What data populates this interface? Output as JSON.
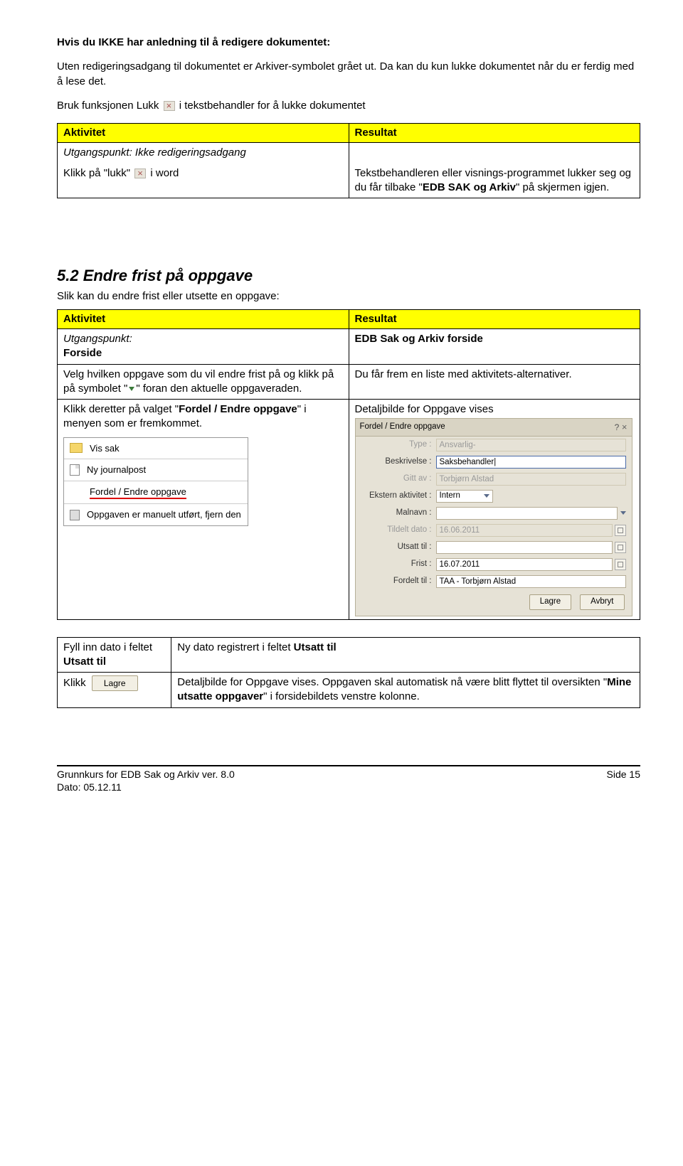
{
  "header": {
    "title": "Hvis du IKKE har anledning til å redigere dokumentet:",
    "intro_para": "Uten redigeringsadgang til dokumentet er Arkiver-symbolet grået ut. Da kan du kun lukke dokumentet når du er ferdig med å lese det.",
    "bruk_pre": "Bruk funksjonen Lukk ",
    "bruk_post": " i tekstbehandler for å lukke dokumentet"
  },
  "table1": {
    "head_a": "Aktivitet",
    "head_r": "Resultat",
    "utg_label": "Utgangspunkt: Ikke redigeringsadgang",
    "klikk_pre": "Klikk på \"lukk\" ",
    "klikk_post": " i word",
    "result_pre": "Tekstbehandleren eller visnings-programmet lukker seg og du får tilbake \"",
    "result_bold": "EDB SAK og Arkiv",
    "result_post": "\" på skjermen igjen."
  },
  "section52": {
    "heading": "5.2    Endre frist på oppgave",
    "intro": "Slik kan du endre frist eller utsette en oppgave:"
  },
  "table2": {
    "head_a": "Aktivitet",
    "head_r": "Resultat",
    "utg_label": "Utgangspunkt:",
    "forside": "Forside",
    "forside_r": "EDB Sak og Arkiv forside",
    "velg_pre": "Velg hvilken oppgave som du vil endre frist på og klikk på på symbolet \"",
    "velg_post": "\" foran den aktuelle oppgaveraden.",
    "velg_r": "Du får frem en liste med aktivitets-alternativer.",
    "klikk2_pre": "Klikk deretter på valget \"",
    "klikk2_bold": "Fordel / Endre oppgave",
    "klikk2_post": "\" i menyen som er fremkommet.",
    "detalj_r": "Detaljbilde for Oppgave vises"
  },
  "ctxmenu": {
    "vis_sak": "Vis sak",
    "ny_jp": "Ny journalpost",
    "fordel": "Fordel / Endre oppgave",
    "utfort": "Oppgaven er manuelt utført, fjern den"
  },
  "form": {
    "title": "Fordel / Endre oppgave",
    "type_lbl": "Type :",
    "type_val": "Ansvarlig-",
    "besk_lbl": "Beskrivelse :",
    "besk_val": "Saksbehandler",
    "gitt_lbl": "Gitt av :",
    "gitt_val": "Torbjørn Alstad",
    "ekstern_lbl": "Ekstern aktivitet :",
    "ekstern_val": "Intern",
    "malnavn_lbl": "Malnavn :",
    "tildelt_lbl": "Tildelt dato :",
    "tildelt_val": "16.06.2011",
    "utsatt_lbl": "Utsatt til :",
    "frist_lbl": "Frist :",
    "frist_val": "16.07.2011",
    "fordelt_lbl": "Fordelt til :",
    "fordelt_val": "TAA - Torbjørn Alstad",
    "lagre": "Lagre",
    "avbryt": "Avbryt"
  },
  "table3": {
    "fyll_pre": "Fyll inn dato i feltet ",
    "fyll_bold": "Utsatt til",
    "fyll_r_pre": "Ny dato registrert i feltet ",
    "fyll_r_bold": "Utsatt til",
    "klikk_label": "Klikk",
    "lagre_btn": "Lagre",
    "detalj_pre": "Detaljbilde for Oppgave vises. Oppgaven skal automatisk nå være blitt flyttet til oversikten \"",
    "detalj_bold": "Mine utsatte oppgaver",
    "detalj_post": "\" i forsidebildets venstre kolonne."
  },
  "footer": {
    "left1": "Grunnkurs for EDB Sak og Arkiv ver. 8.0",
    "left2": "Dato: 05.12.11",
    "right": "Side 15"
  }
}
